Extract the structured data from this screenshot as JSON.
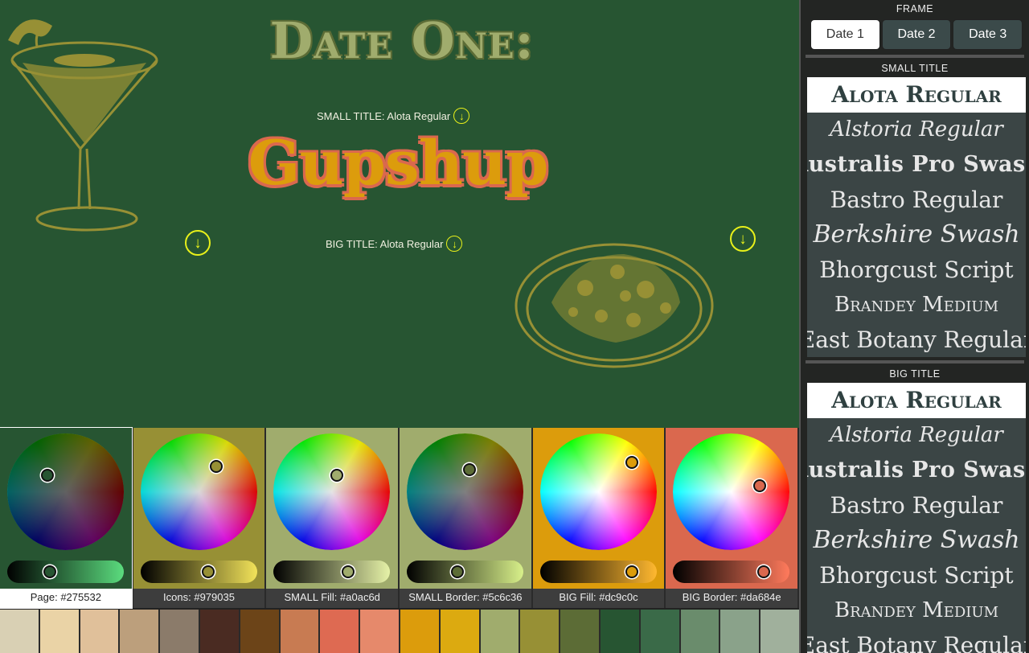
{
  "canvas": {
    "background": "#275532",
    "date_title": "Date One:",
    "big_title": "Gupshup",
    "small_title_label": "SMALL TITLE: Alota Regular",
    "big_title_label": "BIG TITLE: Alota Regular",
    "download_glyph": "↓",
    "icon_color": "#979035"
  },
  "pickers": [
    {
      "label": "Page: #275532",
      "color": "#275532",
      "active": true
    },
    {
      "label": "Icons: #979035",
      "color": "#979035",
      "active": false
    },
    {
      "label": "SMALL Fill: #a0ac6d",
      "color": "#a0ac6d",
      "active": false
    },
    {
      "label": "SMALL Border: #5c6c36",
      "color": "#5c6c36",
      "active": false
    },
    {
      "label": "BIG Fill: #dc9c0c",
      "color": "#dc9c0c",
      "active": false
    },
    {
      "label": "BIG Border: #da684e",
      "color": "#da684e",
      "active": false
    }
  ],
  "swatches": [
    "#d9d0b4",
    "#ead3a6",
    "#e0c09a",
    "#bc9f7c",
    "#8b7b6a",
    "#4a2b22",
    "#6c4418",
    "#c87b52",
    "#de6a52",
    "#e6896b",
    "#dc9c0c",
    "#dcaa10",
    "#a0ac6d",
    "#979035",
    "#5c6c36",
    "#275532",
    "#3a6a48",
    "#6a8c6c",
    "#8aa28a",
    "#a0b09c"
  ],
  "panel": {
    "frame_heading": "FRAME",
    "frames": [
      "Date 1",
      "Date 2",
      "Date 3"
    ],
    "small_heading": "SMALL TITLE",
    "big_heading": "BIG TITLE",
    "fonts": [
      "Alota Regular",
      "Alstoria Regular",
      "Australis Pro Swash",
      "Bastro Regular",
      "Berkshire Swash",
      "Bhorgcust Script",
      "Brandey Medium",
      "East Botany Regular"
    ]
  }
}
